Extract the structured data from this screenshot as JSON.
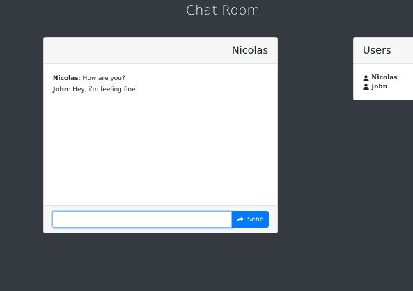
{
  "page": {
    "title": "Chat Room"
  },
  "chat": {
    "header_name": "Nicolas",
    "messages": [
      {
        "name": "Nicolas",
        "text": ": How are you?"
      },
      {
        "name": "John",
        "text": ": Hey, i'm feeling fine"
      }
    ],
    "input_value": "",
    "send_label": "Send",
    "send_icon": "share-icon"
  },
  "users": {
    "header": "Users",
    "list": [
      {
        "name": "Nicolas",
        "icon": "user-icon"
      },
      {
        "name": "John",
        "icon": "user-icon"
      }
    ]
  },
  "colors": {
    "background": "#343a40",
    "primary": "#007bff",
    "card_header": "#f7f7f7"
  }
}
